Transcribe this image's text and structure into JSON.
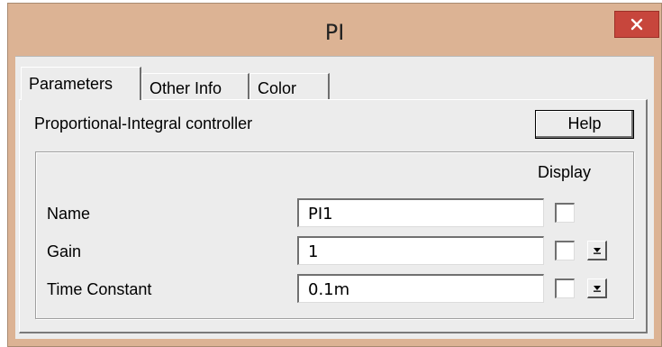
{
  "window": {
    "title": "PI"
  },
  "tabs": [
    {
      "label": "Parameters"
    },
    {
      "label": "Other Info"
    },
    {
      "label": "Color"
    }
  ],
  "panel": {
    "description": "Proportional-Integral controller",
    "help_label": "Help",
    "display_header": "Display",
    "rows": [
      {
        "label": "Name",
        "value": "PI1",
        "display_checked": false,
        "has_dropdown": false
      },
      {
        "label": "Gain",
        "value": "1",
        "display_checked": false,
        "has_dropdown": true
      },
      {
        "label": "Time Constant",
        "value": "0.1m",
        "display_checked": false,
        "has_dropdown": true
      }
    ]
  },
  "colors": {
    "title_bar": "#dcb394",
    "close_button": "#c7463c",
    "client_bg": "#ececec"
  },
  "icons": {
    "close": "close-icon",
    "dropdown": "dropdown-arrow-icon"
  }
}
